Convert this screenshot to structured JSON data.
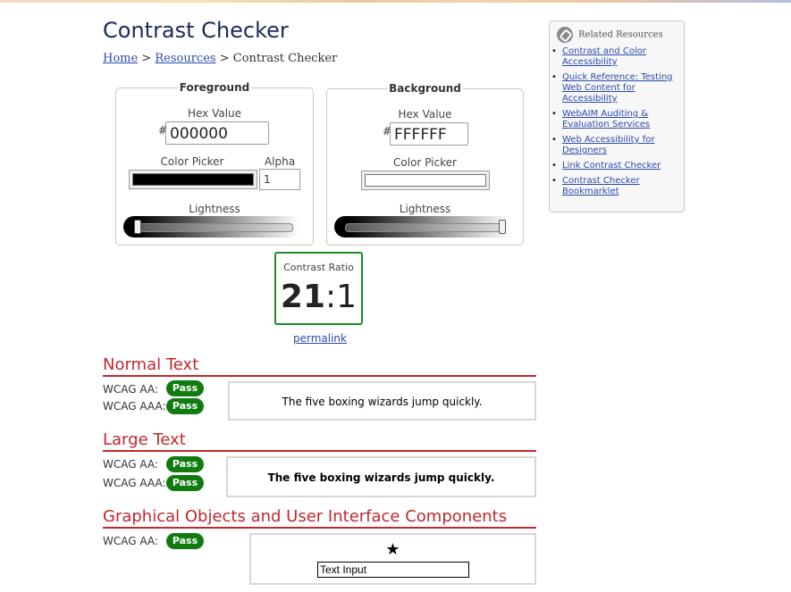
{
  "page": {
    "title": "Contrast Checker"
  },
  "breadcrumb": {
    "home": "Home",
    "resources": "Resources",
    "current": "Contrast Checker",
    "sep": ">"
  },
  "foreground": {
    "legend": "Foreground",
    "hex_label": "Hex Value",
    "hash": "#",
    "hex_value": "000000",
    "color_picker_label": "Color Picker",
    "color_value": "#000000",
    "alpha_label": "Alpha",
    "alpha_value": "1",
    "lightness_label": "Lightness",
    "lightness_level": 0
  },
  "background": {
    "legend": "Background",
    "hex_label": "Hex Value",
    "hash": "#",
    "hex_value": "FFFFFF",
    "color_picker_label": "Color Picker",
    "color_value": "#FFFFFF",
    "lightness_label": "Lightness",
    "lightness_level": 1
  },
  "contrast": {
    "label": "Contrast Ratio",
    "ratio_main": "21",
    "ratio_rest": ":1",
    "permalink": "permalink"
  },
  "normal_text": {
    "title": "Normal Text",
    "aa_label": "WCAG AA:",
    "aa_result": "Pass",
    "aaa_label": "WCAG AAA:",
    "aaa_result": "Pass",
    "sample": "The five boxing wizards jump quickly."
  },
  "large_text": {
    "title": "Large Text",
    "aa_label": "WCAG AA:",
    "aa_result": "Pass",
    "aaa_label": "WCAG AAA:",
    "aaa_result": "Pass",
    "sample": "The five boxing wizards jump quickly."
  },
  "graphical": {
    "title": "Graphical Objects and User Interface Components",
    "aa_label": "WCAG AA:",
    "aa_result": "Pass",
    "star": "★",
    "input_text": "Text Input"
  },
  "related": {
    "heading": "Related Resources",
    "items": [
      "Contrast and Color Accessibility",
      "Quick Reference: Testing Web Content for Accessibility",
      "WebAIM Auditing & Evaluation Services",
      "Web Accessibility for Designers",
      "Link Contrast Checker",
      "Contrast Checker Bookmarklet"
    ]
  },
  "colors": {
    "pass": "#107c10",
    "accent_red": "#c0282e",
    "link": "#2b4aa8",
    "ratio_border": "#1e8a2a"
  }
}
